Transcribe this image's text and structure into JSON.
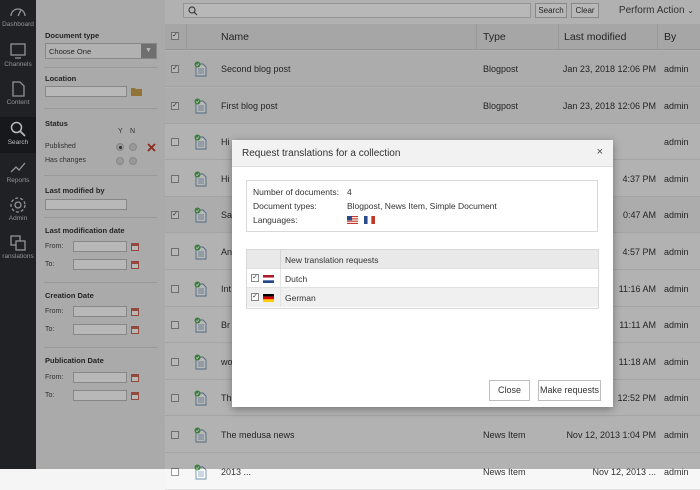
{
  "nav": {
    "items": [
      {
        "label": "Dashboard",
        "icon": "dashboard-icon"
      },
      {
        "label": "Channels",
        "icon": "channels-icon"
      },
      {
        "label": "Content",
        "icon": "content-icon"
      },
      {
        "label": "Search",
        "icon": "search-icon",
        "active": true
      },
      {
        "label": "Reports",
        "icon": "reports-icon"
      },
      {
        "label": "Admin",
        "icon": "admin-icon"
      },
      {
        "label": "ranslations",
        "icon": "translations-icon"
      }
    ]
  },
  "filters": {
    "document_type": {
      "label": "Document type",
      "value": "Choose One"
    },
    "location": {
      "label": "Location"
    },
    "status": {
      "label": "Status",
      "yes": "Y",
      "no": "N",
      "published": "Published",
      "has_changes": "Has changes"
    },
    "last_modified_by": {
      "label": "Last modified by"
    },
    "last_modification_date": {
      "label": "Last modification date",
      "from": "From:",
      "to": "To:"
    },
    "creation_date": {
      "label": "Creation Date",
      "from": "From:",
      "to": "To:"
    },
    "publication_date": {
      "label": "Publication Date",
      "from": "From:",
      "to": "To:"
    }
  },
  "topbar": {
    "search_label": "Search",
    "clear_label": "Clear",
    "perform_action": "Perform Action"
  },
  "table": {
    "headers": {
      "name": "Name",
      "type": "Type",
      "last_modified": "Last modified",
      "by": "By"
    },
    "rows": [
      {
        "name": "Second blog post",
        "type": "Blogpost",
        "modified": "Jan 23, 2018 12:06 PM",
        "by": "admin",
        "checked": true
      },
      {
        "name": "First blog post",
        "type": "Blogpost",
        "modified": "Jan 23, 2018 12:06 PM",
        "by": "admin",
        "checked": true
      },
      {
        "name": "Hi",
        "type": "",
        "modified": "",
        "by": "admin",
        "checked": false
      },
      {
        "name": "Hi",
        "type": "",
        "modified": "4:37 PM",
        "by": "admin",
        "checked": false
      },
      {
        "name": "Sa",
        "type": "",
        "modified": "0:47 AM",
        "by": "admin",
        "checked": true
      },
      {
        "name": "An",
        "type": "",
        "modified": "4:57 PM",
        "by": "admin",
        "checked": false
      },
      {
        "name": "Int",
        "type": "",
        "modified": "11:16 AM",
        "by": "admin",
        "checked": false
      },
      {
        "name": "Br",
        "type": "",
        "modified": "11:11 AM",
        "by": "admin",
        "checked": false
      },
      {
        "name": "wo",
        "type": "",
        "modified": "11:18 AM",
        "by": "admin",
        "checked": false
      },
      {
        "name": "Th",
        "type": "",
        "modified": "12:52 PM",
        "by": "admin",
        "checked": false
      },
      {
        "name": "The medusa news",
        "type": "News Item",
        "modified": "Nov 12, 2013 1:04 PM",
        "by": "admin",
        "checked": false
      },
      {
        "name": "2013 ...",
        "type": "News Item",
        "modified": "Nov 12, 2013 ...",
        "by": "admin",
        "checked": false
      }
    ]
  },
  "modal": {
    "title": "Request translations for a collection",
    "close_glyph": "×",
    "num_docs_label": "Number of documents:",
    "num_docs_value": "4",
    "doc_types_label": "Document types:",
    "doc_types_value": "Blogpost, News Item, Simple Document",
    "languages_label": "Languages:",
    "table_header": "New translation requests",
    "requests": [
      {
        "language": "Dutch",
        "flag": "nl-flag-icon",
        "checked": true
      },
      {
        "language": "German",
        "flag": "de-flag-icon",
        "checked": true
      }
    ],
    "close_button": "Close",
    "submit_button": "Make requests"
  },
  "colors": {
    "nav_bg": "#2b2f33",
    "accent_red": "#c0392b",
    "check_green": "#4caf50"
  }
}
